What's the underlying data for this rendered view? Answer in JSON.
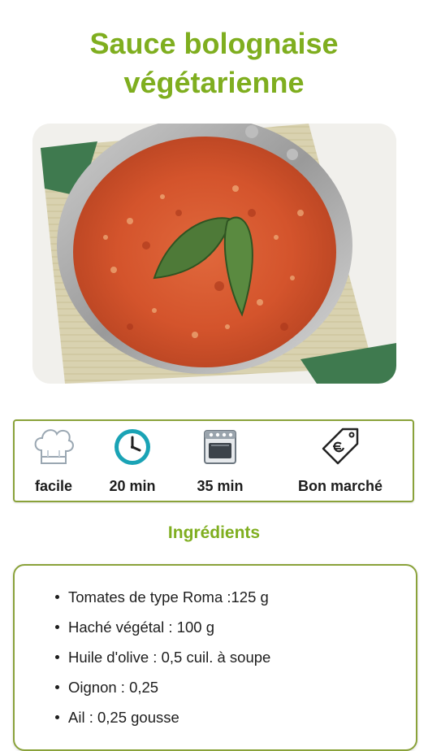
{
  "recipe": {
    "title_line1": "Sauce bolognaise",
    "title_line2": "végétarienne",
    "image_alt": "Sauce bolognaise végétarienne dans une poêle avec feuilles de laurier"
  },
  "info": {
    "difficulty": {
      "icon": "chef-hat-icon",
      "label": "facile"
    },
    "prep_time": {
      "icon": "clock-icon",
      "label": "20 min"
    },
    "cook_time": {
      "icon": "oven-icon",
      "label": "35 min"
    },
    "cost": {
      "icon": "price-tag-icon",
      "label": "Bon marché"
    }
  },
  "ingredients": {
    "heading": "Ingrédients",
    "items": [
      "Tomates de type Roma  :125 g",
      "Haché végétal  : 100 g",
      "Huile d'olive  : 0,5 cuil. à soupe",
      "Oignon  : 0,25",
      "Ail  : 0,25 gousse"
    ]
  },
  "colors": {
    "accent_green": "#7fae1f",
    "border_green": "#8aa23a",
    "clock_teal": "#1aa3b5"
  }
}
